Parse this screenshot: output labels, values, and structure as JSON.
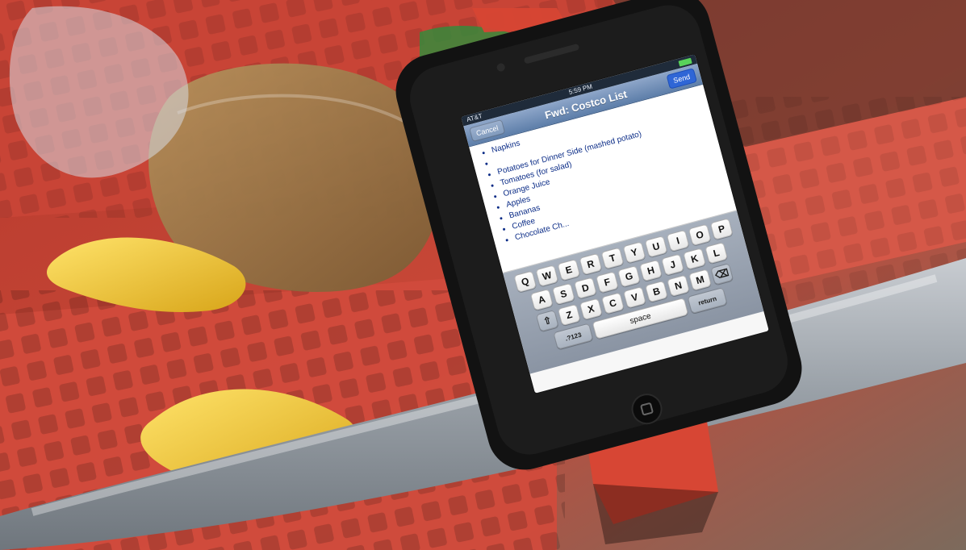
{
  "phone": {
    "status_bar": {
      "carrier": "AT&T",
      "time": "5:59 PM"
    },
    "navigation": {
      "cancel_label": "Cancel",
      "title": "Fwd: Costco List",
      "send_label": "Send"
    },
    "email": {
      "items": [
        "Napkins",
        "",
        "Potatoes for Dinner Side (mashed potato)",
        "Tomatoes (for salad)",
        "Orange Juice",
        "Apples",
        "Bananas",
        "Coffee",
        "Chocolate Ch..."
      ]
    },
    "keyboard": {
      "row1": [
        "Q",
        "W",
        "E",
        "R",
        "T",
        "Y",
        "U",
        "I",
        "O",
        "P"
      ],
      "row2": [
        "A",
        "S",
        "D",
        "F",
        "G",
        "H",
        "J",
        "K",
        "L"
      ],
      "row3": [
        "Z",
        "X",
        "C",
        "V",
        "B",
        "N",
        "M"
      ],
      "bottom": {
        "numbers_label": ".?123",
        "space_label": "space",
        "return_label": "return"
      }
    }
  },
  "icons": {
    "shift": "shift-icon",
    "backspace": "backspace-icon",
    "battery": "battery-icon"
  },
  "colors": {
    "cart_red": "#d64a3a",
    "handle_gray": "#8f959b",
    "banana_yellow": "#f5cf2d",
    "phone_black": "#121212",
    "nav_blue": "#6a8ab4",
    "send_blue": "#2f66d6"
  }
}
